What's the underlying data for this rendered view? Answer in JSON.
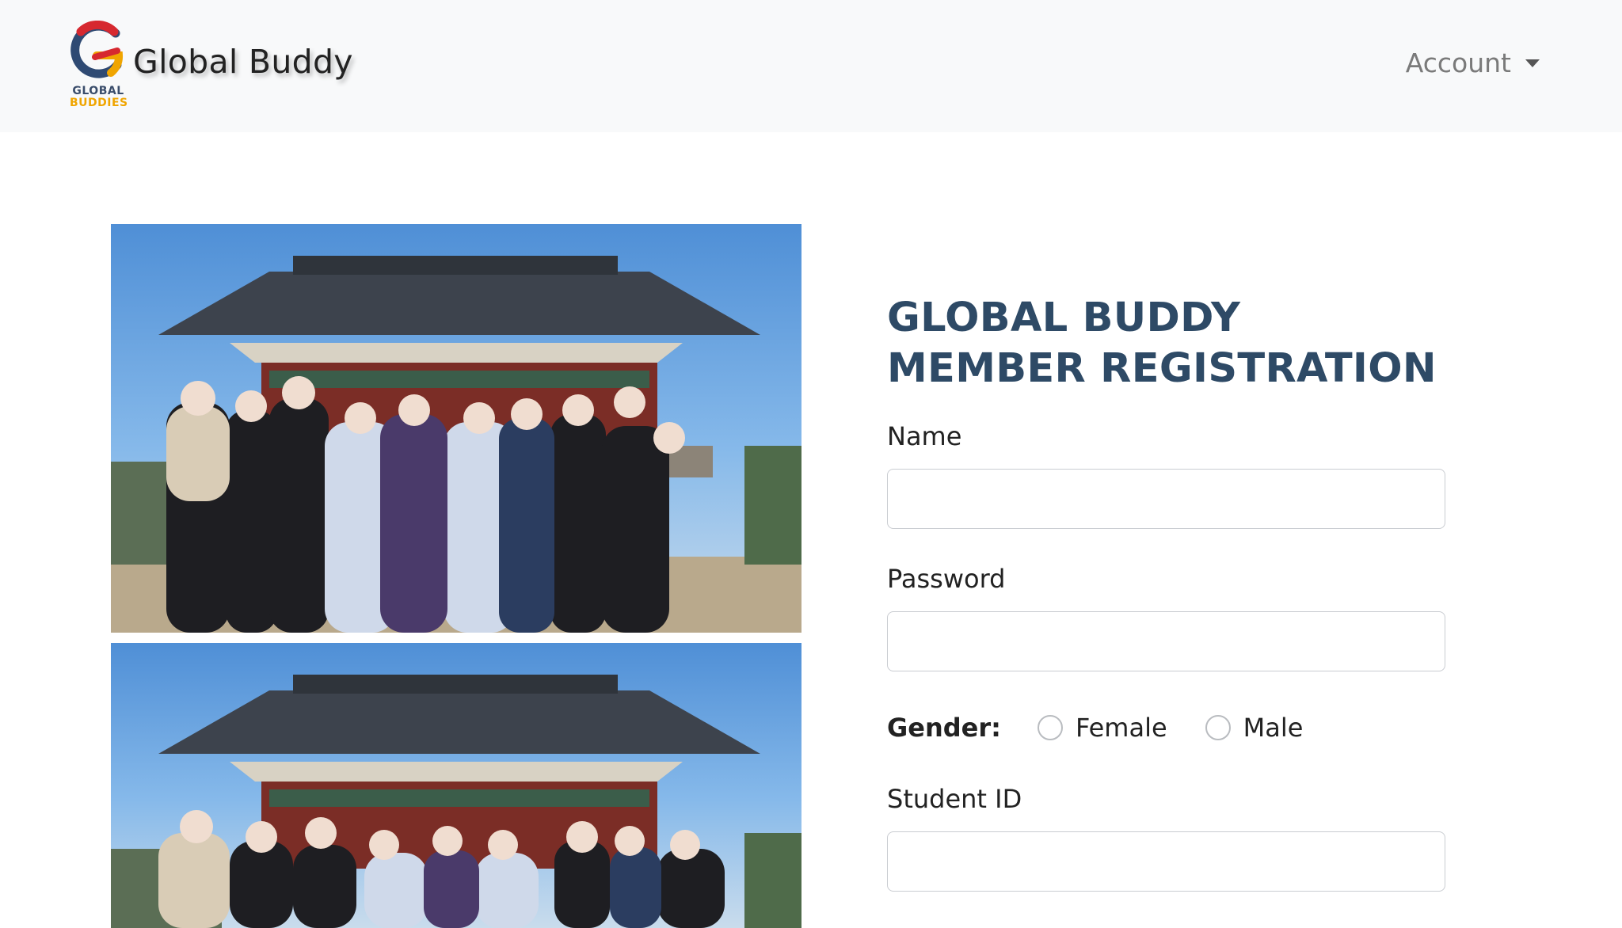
{
  "navbar": {
    "brand_name": "Global Buddy",
    "logo_text_line1": "GLOBAL",
    "logo_text_line2": "BUDDIES",
    "account_label": "Account"
  },
  "form": {
    "title": "GLOBAL BUDDY MEMBER REGISTRATION",
    "name_label": "Name",
    "name_value": "",
    "password_label": "Password",
    "password_value": "",
    "gender_label": "Gender:",
    "gender_options": [
      "Female",
      "Male"
    ],
    "student_id_label": "Student ID",
    "student_id_value": ""
  },
  "colors": {
    "title": "#2e4a66",
    "navbar_bg": "#f8f9fa",
    "logo_red": "#d6282f",
    "logo_navy": "#2f4a73",
    "logo_yellow": "#f0a500"
  },
  "icons": {
    "account_caret": "caret-down-icon",
    "logo": "global-buddies-logo"
  }
}
